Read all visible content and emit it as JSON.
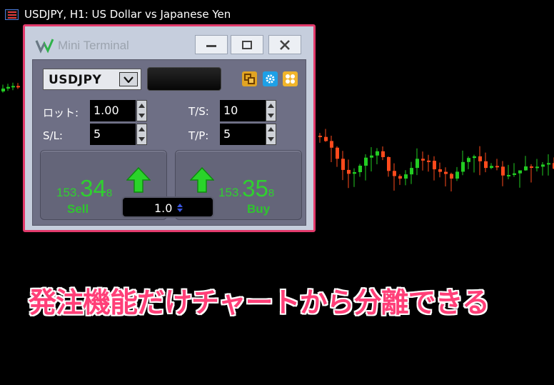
{
  "chart": {
    "title": "USDJPY, H1:  US Dollar vs Japanese Yen",
    "bull_color": "#22cc22",
    "bear_color": "#ff4a1c"
  },
  "terminal": {
    "title": "Mini Terminal",
    "symbol": "USDJPY",
    "lot_label": "ロット:",
    "lot_value": "1.00",
    "sl_label": "S/L:",
    "sl_value": "5",
    "ts_label": "T/S:",
    "ts_value": "10",
    "tp_label": "T/P:",
    "tp_value": "5",
    "sell": {
      "label": "Sell",
      "price_small": "153.",
      "price_big": "34",
      "price_frac": "8"
    },
    "buy": {
      "label": "Buy",
      "price_small": "153.",
      "price_big": "35",
      "price_frac": "8"
    },
    "lot_step": "1.0",
    "icons": [
      "minimize-icon",
      "restore-icon",
      "close-icon",
      "copy-icon",
      "gear-icon",
      "grid-icon"
    ]
  },
  "caption": "発注機能だけチャートから分離できる"
}
